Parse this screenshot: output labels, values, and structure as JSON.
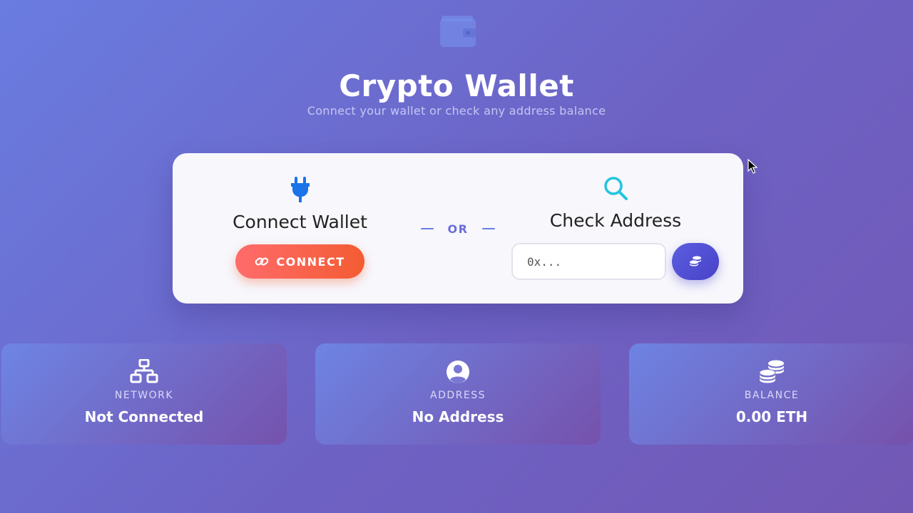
{
  "header": {
    "title": "Crypto Wallet",
    "subtitle": "Connect your wallet or check any address balance",
    "logo_icon": "wallet-icon"
  },
  "connect_panel": {
    "icon": "plug-icon",
    "title": "Connect Wallet",
    "button_label": "CONNECT",
    "button_icon": "link-icon"
  },
  "divider": {
    "label": "OR"
  },
  "check_panel": {
    "icon": "search-icon",
    "title": "Check Address",
    "input_placeholder": "0x...",
    "button_icon": "coins-icon"
  },
  "stats": [
    {
      "icon": "network-icon",
      "label": "NETWORK",
      "value": "Not Connected"
    },
    {
      "icon": "user-circle-icon",
      "label": "ADDRESS",
      "value": "No Address"
    },
    {
      "icon": "coins-icon",
      "label": "BALANCE",
      "value": "0.00 ETH"
    }
  ],
  "colors": {
    "accent": "#5a5ee0",
    "connect_gradient_start": "#ff6b6b",
    "connect_gradient_end": "#f35c32",
    "search_icon": "#22c4dc",
    "plug_icon": "#1a73e8"
  }
}
